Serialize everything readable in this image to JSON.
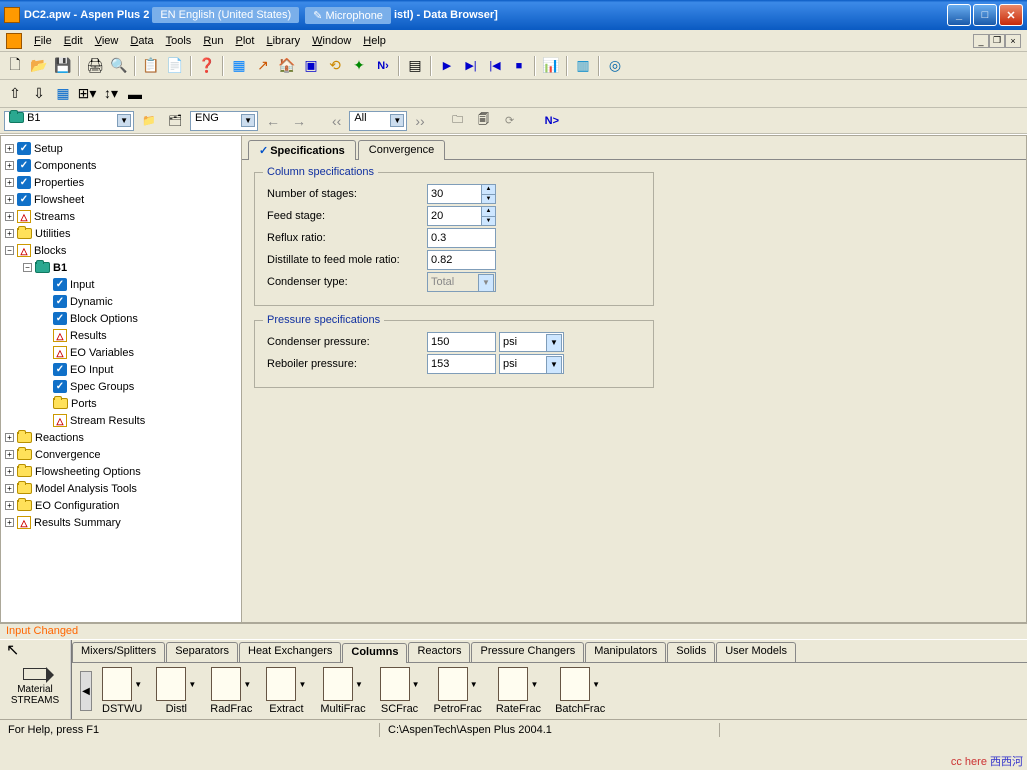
{
  "title": {
    "file": "DC2.apw",
    "app": "Aspen Plus 2",
    "lang": "EN English (United States)",
    "mic": "Microphone",
    "suffix": "istl) - Data Browser]"
  },
  "menu": [
    "File",
    "Edit",
    "View",
    "Data",
    "Tools",
    "Run",
    "Plot",
    "Library",
    "Window",
    "Help"
  ],
  "nav": {
    "block": "B1",
    "units": "ENG",
    "filter": "All",
    "next": "N>"
  },
  "tree": {
    "top": [
      {
        "label": "Setup",
        "ico": "check"
      },
      {
        "label": "Components",
        "ico": "check"
      },
      {
        "label": "Properties",
        "ico": "check"
      },
      {
        "label": "Flowsheet",
        "ico": "check"
      },
      {
        "label": "Streams",
        "ico": "warn"
      },
      {
        "label": "Utilities",
        "ico": "folder"
      }
    ],
    "blocks_label": "Blocks",
    "b1_label": "B1",
    "b1_children": [
      {
        "label": "Input",
        "ico": "check"
      },
      {
        "label": "Dynamic",
        "ico": "check"
      },
      {
        "label": "Block Options",
        "ico": "check"
      },
      {
        "label": "Results",
        "ico": "warn"
      },
      {
        "label": "EO Variables",
        "ico": "warn"
      },
      {
        "label": "EO Input",
        "ico": "check"
      },
      {
        "label": "Spec Groups",
        "ico": "check"
      },
      {
        "label": "Ports",
        "ico": "folder"
      },
      {
        "label": "Stream Results",
        "ico": "warn"
      }
    ],
    "bottom": [
      {
        "label": "Reactions",
        "ico": "folder"
      },
      {
        "label": "Convergence",
        "ico": "folder"
      },
      {
        "label": "Flowsheeting Options",
        "ico": "folder"
      },
      {
        "label": "Model Analysis Tools",
        "ico": "folder"
      },
      {
        "label": "EO Configuration",
        "ico": "folder"
      },
      {
        "label": "Results Summary",
        "ico": "warn"
      }
    ]
  },
  "tabs": {
    "spec": "Specifications",
    "conv": "Convergence"
  },
  "colspec": {
    "legend": "Column specifications",
    "nstages_l": "Number of stages:",
    "nstages_v": "30",
    "feed_l": "Feed stage:",
    "feed_v": "20",
    "reflux_l": "Reflux ratio:",
    "reflux_v": "0.3",
    "dfr_l": "Distillate to feed mole ratio:",
    "dfr_v": "0.82",
    "cond_l": "Condenser type:",
    "cond_v": "Total"
  },
  "press": {
    "legend": "Pressure specifications",
    "condp_l": "Condenser pressure:",
    "condp_v": "150",
    "condp_u": "psi",
    "rebp_l": "Reboiler pressure:",
    "rebp_v": "153",
    "rebp_u": "psi"
  },
  "inputChanged": "Input Changed",
  "ml": {
    "stream_btn": "Material\nSTREAMS",
    "tabs": [
      "Mixers/Splitters",
      "Separators",
      "Heat Exchangers",
      "Columns",
      "Reactors",
      "Pressure Changers",
      "Manipulators",
      "Solids",
      "User Models"
    ],
    "active_tab": 3,
    "items": [
      "DSTWU",
      "Distl",
      "RadFrac",
      "Extract",
      "MultiFrac",
      "SCFrac",
      "PetroFrac",
      "RateFrac",
      "BatchFrac"
    ]
  },
  "status": {
    "help": "For Help, press F1",
    "path": "C:\\AspenTech\\Aspen Plus 2004.1"
  },
  "watermark": {
    "a": "cc here",
    "b": "西西河"
  }
}
